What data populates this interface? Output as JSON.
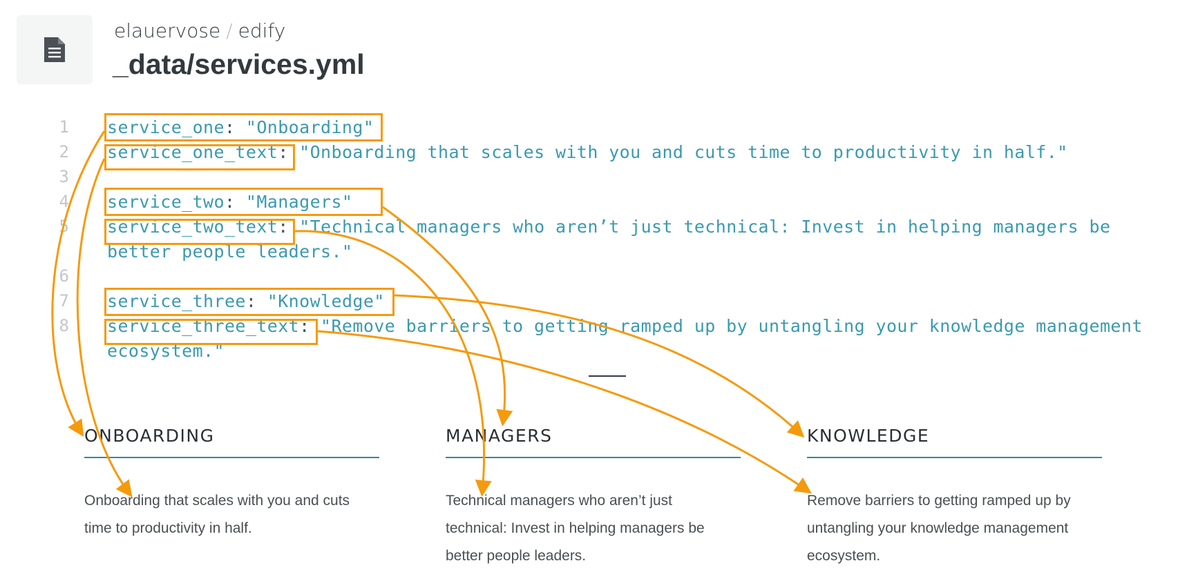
{
  "header": {
    "owner": "elauervose",
    "separator": "/",
    "repo": "edify",
    "file_icon": "document-icon",
    "filename": "_data/services.yml"
  },
  "code_lines": [
    {
      "num": "1",
      "key": "service_one",
      "value": "\"Onboarding\""
    },
    {
      "num": "2",
      "key": "service_one_text",
      "value": "\"Onboarding that scales with you and cuts time to productivity in half.\""
    },
    {
      "num": "3"
    },
    {
      "num": "4",
      "key": "service_two",
      "value": "\"Managers\""
    },
    {
      "num": "5",
      "key": "service_two_text",
      "value": "\"Technical managers who aren’t just technical: Invest in helping managers be",
      "cont": "better people leaders.\""
    },
    {
      "num": "6"
    },
    {
      "num": "7",
      "key": "service_three",
      "value": "\"Knowledge\""
    },
    {
      "num": "8",
      "key": "service_three_text",
      "value": "\"Remove barriers to getting ramped up by untangling your knowledge management",
      "cont": "ecosystem.\""
    }
  ],
  "services": [
    {
      "title": "ONBOARDING",
      "text": "Onboarding that scales with you and cuts time to productivity in half."
    },
    {
      "title": "MANAGERS",
      "text": "Technical managers who aren’t just technical: Invest in helping managers be better people leaders."
    },
    {
      "title": "KNOWLEDGE",
      "text": "Remove barriers to getting ramped up by untangling your knowledge management ecosystem."
    }
  ],
  "colors": {
    "highlight": "#f59a0c",
    "code": "#3a9ab0",
    "rule": "#2f8a98"
  }
}
